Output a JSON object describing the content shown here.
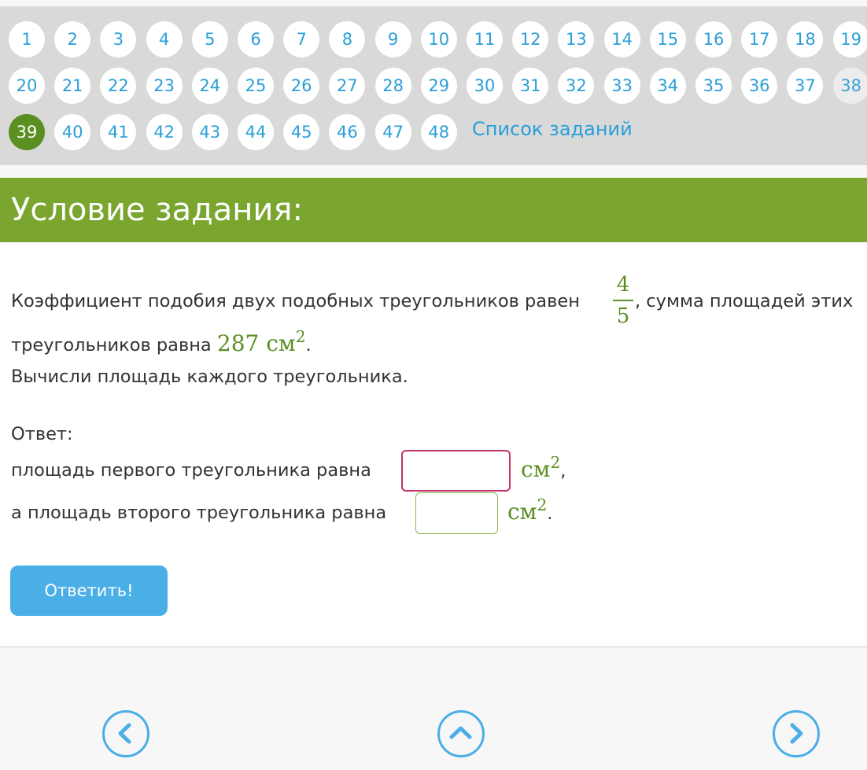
{
  "nav": {
    "numbers": [
      "1",
      "2",
      "3",
      "4",
      "5",
      "6",
      "7",
      "8",
      "9",
      "10",
      "11",
      "12",
      "13",
      "14",
      "15",
      "16",
      "17",
      "18",
      "19",
      "20",
      "21",
      "22",
      "23",
      "24",
      "25",
      "26",
      "27",
      "28",
      "29",
      "30",
      "31",
      "32",
      "33",
      "34",
      "35",
      "36",
      "37",
      "38",
      "39",
      "40",
      "41",
      "42",
      "43",
      "44",
      "45",
      "46",
      "47",
      "48"
    ],
    "current": "39",
    "visited": [
      "38"
    ],
    "task_list_label": "Список заданий"
  },
  "header": {
    "title": "Условие задания:"
  },
  "problem": {
    "line1_text": "Коэффициент подобия двух подобных треугольников равен",
    "fraction_numerator": "4",
    "fraction_denominator": "5",
    "line1_after": ", сумма площадей этих",
    "line2_text": "треугольников равна",
    "area_value": "287 см",
    "area_exponent": "2",
    "line2_end": ".",
    "line3_text": "Вычисли площадь каждого треугольника."
  },
  "answer": {
    "label": "Ответ:",
    "first_label": "площадь первого треугольника равна",
    "first_unit": "см",
    "first_exponent": "2",
    "first_end": ",",
    "second_label": "а площадь второго треугольника равна",
    "second_unit": "см",
    "second_exponent": "2",
    "second_end": ".",
    "first_value": "",
    "second_value": ""
  },
  "submit_label": "Ответить!",
  "footer_icons": {
    "prev": "chevron-left-icon",
    "up": "chevron-up-icon",
    "next": "chevron-right-icon"
  },
  "colors": {
    "accent_green": "#7aa52e",
    "current_green": "#5b8f22",
    "link_blue": "#2a9fd8",
    "button_blue": "#4aaee7",
    "error_border": "#c2336c"
  }
}
